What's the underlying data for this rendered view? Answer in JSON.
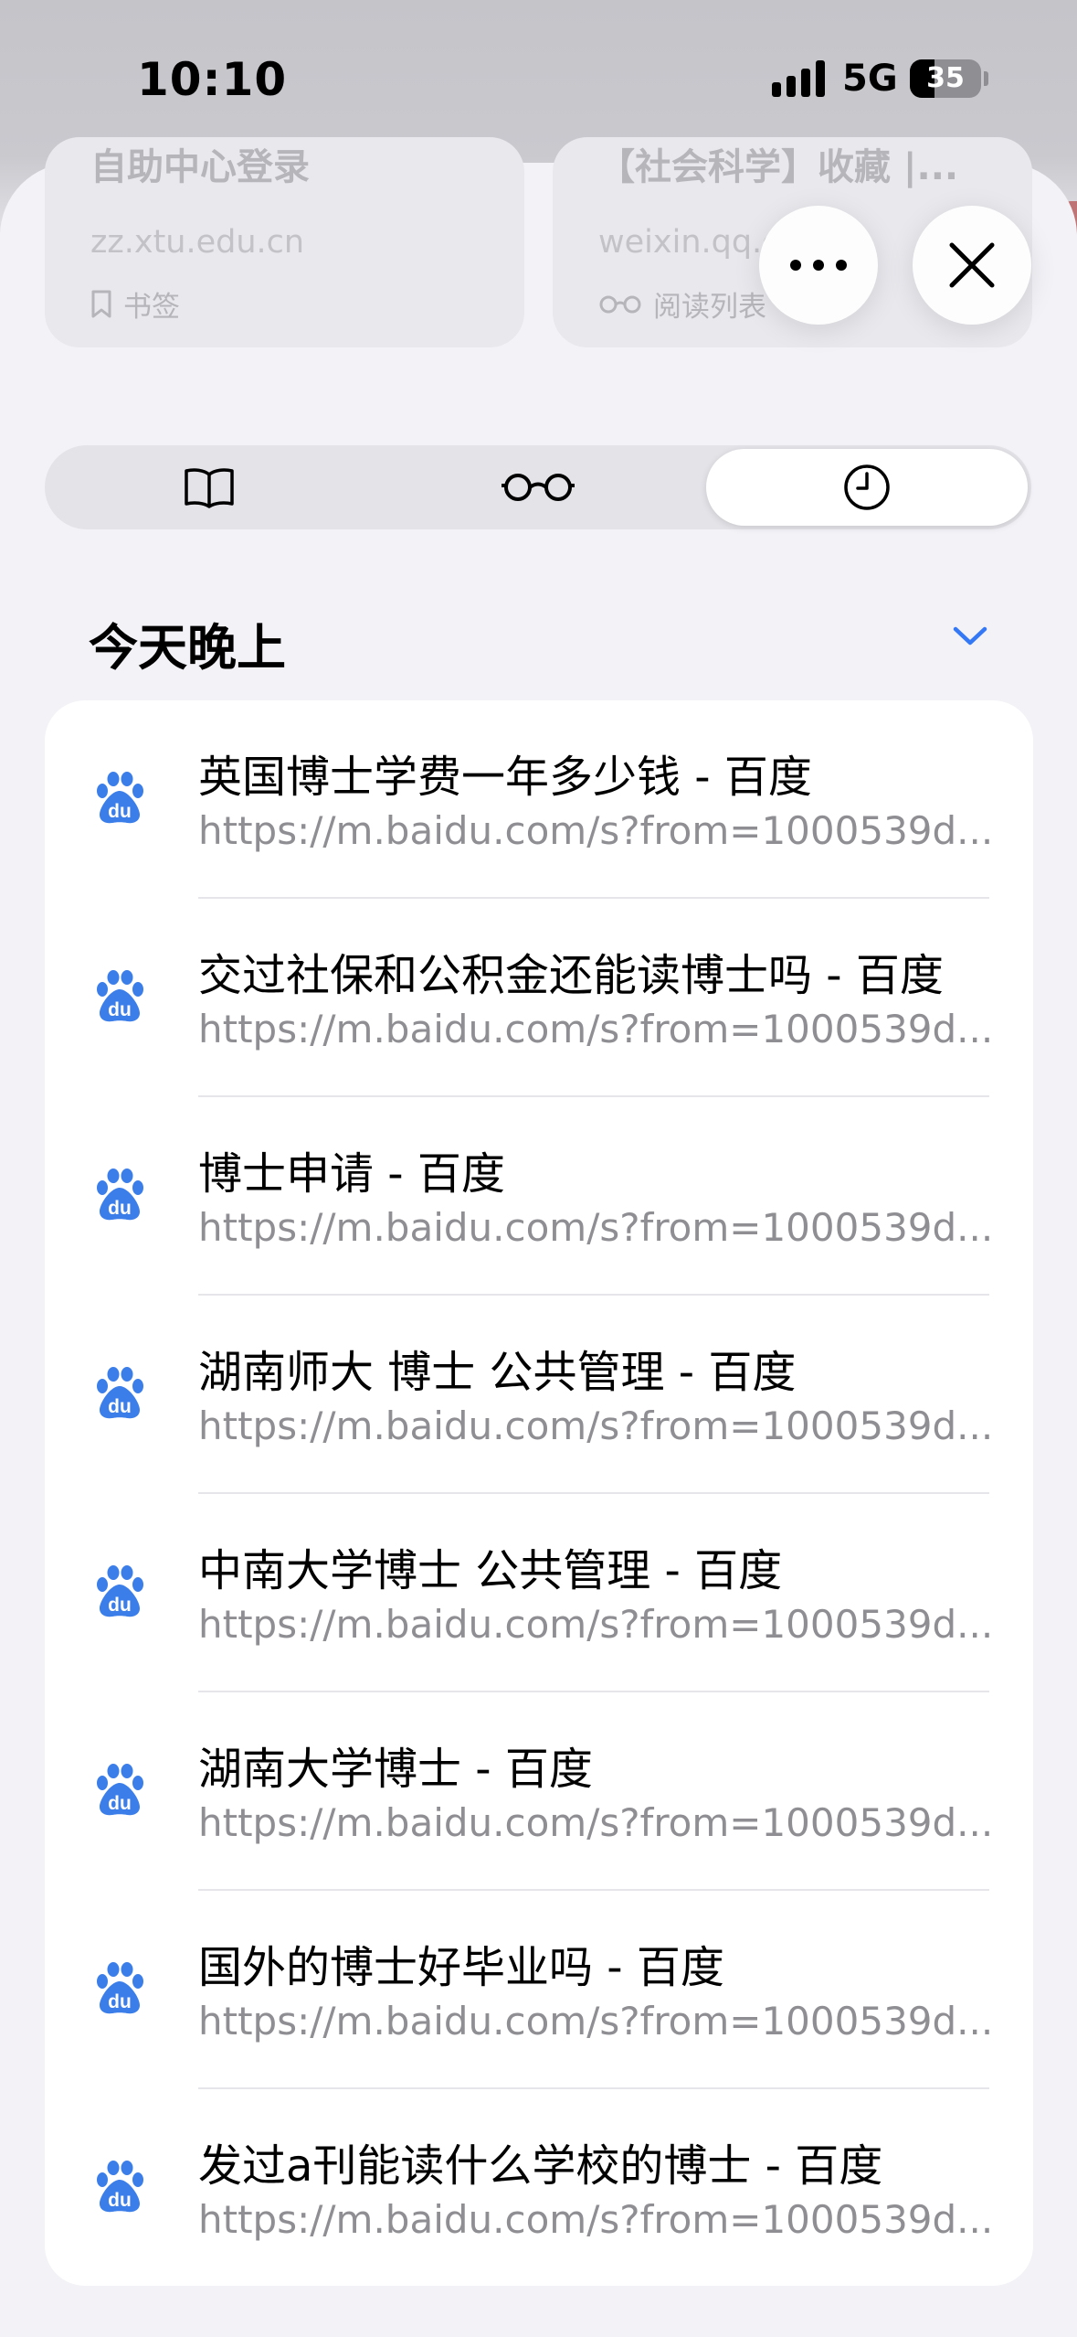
{
  "status_bar": {
    "time": "10:10",
    "network": "5G",
    "battery_level": 35,
    "battery_text": "35"
  },
  "top_cards": [
    {
      "title": "自助中心登录",
      "url": "zz.xtu.edu.cn",
      "tag": "书签",
      "tag_icon": "bookmark-icon"
    },
    {
      "title": "【社会科学】收藏 |...",
      "url": "weixin.qq.com",
      "tag": "阅读列表",
      "tag_icon": "glasses-icon"
    }
  ],
  "buttons": {
    "more_icon": "ellipsis-icon",
    "close_icon": "close-icon"
  },
  "tabs": [
    {
      "icon": "book-icon",
      "label": "书签",
      "active": false
    },
    {
      "icon": "glasses-icon",
      "label": "阅读列表",
      "active": false
    },
    {
      "icon": "clock-icon",
      "label": "历史记录",
      "active": true
    }
  ],
  "history": {
    "section_title": "今天晚上",
    "accent_color": "#3478f6",
    "favicon_color": "#3b7ee9",
    "items": [
      {
        "title": "英国博士学费一年多少钱 - 百度",
        "url": "https://m.baidu.com/s?from=1000539d..."
      },
      {
        "title": "交过社保和公积金还能读博士吗 - 百度",
        "url": "https://m.baidu.com/s?from=1000539d..."
      },
      {
        "title": "博士申请 - 百度",
        "url": "https://m.baidu.com/s?from=1000539d..."
      },
      {
        "title": "湖南师大 博士 公共管理 - 百度",
        "url": "https://m.baidu.com/s?from=1000539d..."
      },
      {
        "title": "中南大学博士 公共管理 - 百度",
        "url": "https://m.baidu.com/s?from=1000539d..."
      },
      {
        "title": "湖南大学博士 - 百度",
        "url": "https://m.baidu.com/s?from=1000539d..."
      },
      {
        "title": "国外的博士好毕业吗 - 百度",
        "url": "https://m.baidu.com/s?from=1000539d..."
      },
      {
        "title": "发过a刊能读什么学校的博士 - 百度",
        "url": "https://m.baidu.com/s?from=1000539d..."
      }
    ]
  }
}
